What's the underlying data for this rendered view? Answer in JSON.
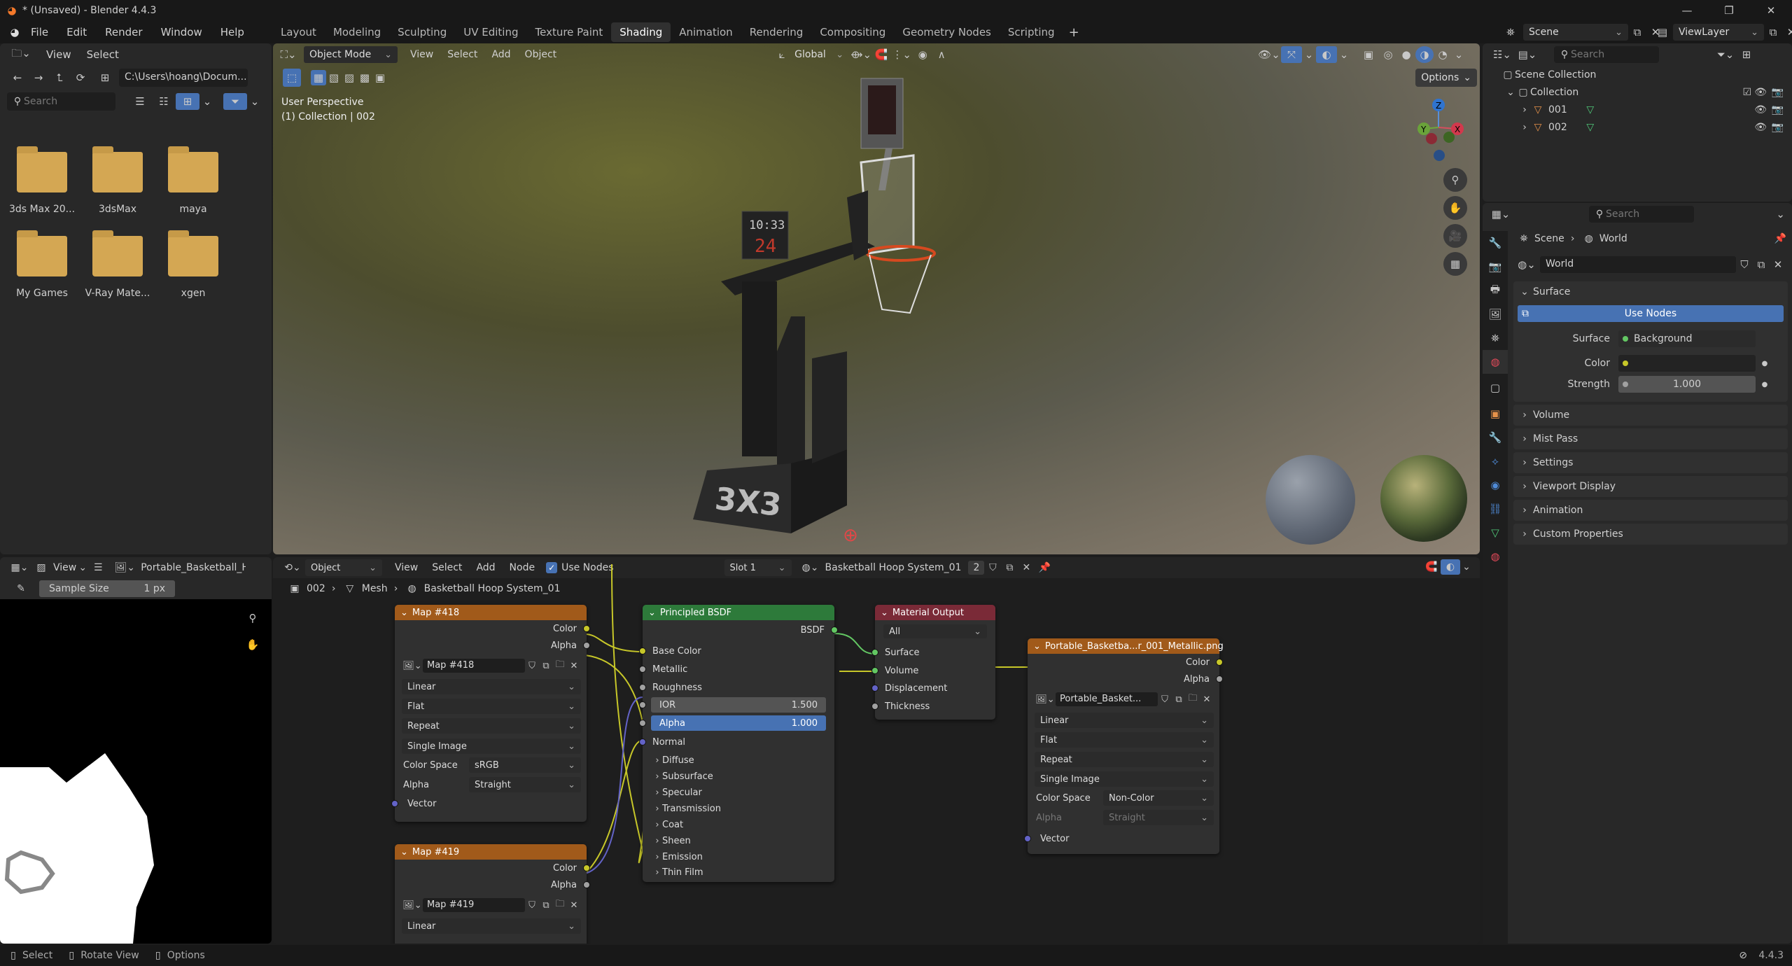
{
  "window": {
    "title": "* (Unsaved) - Blender 4.4.3"
  },
  "menu": [
    "File",
    "Edit",
    "Render",
    "Window",
    "Help"
  ],
  "workspaces": [
    "Layout",
    "Modeling",
    "Sculpting",
    "UV Editing",
    "Texture Paint",
    "Shading",
    "Animation",
    "Rendering",
    "Compositing",
    "Geometry Nodes",
    "Scripting"
  ],
  "active_workspace": "Shading",
  "scene": {
    "name": "Scene",
    "view_layer": "ViewLayer"
  },
  "filebrowser": {
    "menu": [
      "View",
      "Select"
    ],
    "path": "C:\\Users\\hoang\\Docum...",
    "search_placeholder": "Search",
    "folders": [
      "3ds Max 20...",
      "3dsMax",
      "maya",
      "My Games",
      "V-Ray Mate...",
      "xgen"
    ]
  },
  "viewport": {
    "mode": "Object Mode",
    "menu": [
      "View",
      "Select",
      "Add",
      "Object"
    ],
    "orientation": "Global",
    "options": "Options",
    "overlay_line1": "User Perspective",
    "overlay_line2": "(1) Collection | 002",
    "gizmo": {
      "x": "X",
      "y": "Y",
      "z": "Z"
    },
    "scene_text": {
      "board": "3X3",
      "clock": "10:33",
      "shot": "24"
    }
  },
  "outliner": {
    "search_placeholder": "Search",
    "root": "Scene Collection",
    "collection": "Collection",
    "items": [
      "001",
      "002"
    ]
  },
  "properties": {
    "search_placeholder": "Search",
    "breadcrumb": [
      "Scene",
      "World"
    ],
    "world_name": "World",
    "surface_panel": "Surface",
    "use_nodes": "Use Nodes",
    "surface_label": "Surface",
    "surface_value": "Background",
    "color_label": "Color",
    "strength_label": "Strength",
    "strength_value": "1.000",
    "panels": [
      "Volume",
      "Mist Pass",
      "Settings",
      "Viewport Display",
      "Animation",
      "Custom Properties"
    ]
  },
  "image_editor": {
    "view": "View",
    "image_name": "Portable_Basketball_H",
    "sample_label": "Sample Size",
    "sample_value": "1 px"
  },
  "node_editor": {
    "type": "Object",
    "menu": [
      "View",
      "Select",
      "Add",
      "Node"
    ],
    "use_nodes": "Use Nodes",
    "slot": "Slot 1",
    "material": "Basketball Hoop System_01",
    "users": "2",
    "breadcrumb": [
      "002",
      "Mesh",
      "Basketball Hoop System_01"
    ]
  },
  "nodes": {
    "map418": {
      "title": "Map #418",
      "out": [
        "Color",
        "Alpha"
      ],
      "image": "Map #418",
      "interp": "Linear",
      "proj": "Flat",
      "ext": "Repeat",
      "src": "Single Image",
      "cs_label": "Color Space",
      "cs": "sRGB",
      "alpha_label": "Alpha",
      "alpha": "Straight",
      "vector": "Vector"
    },
    "map419": {
      "title": "Map #419",
      "out": [
        "Color",
        "Alpha"
      ],
      "image": "Map #419",
      "interp": "Linear"
    },
    "bsdf": {
      "title": "Principled BSDF",
      "out": "BSDF",
      "inputs": [
        "Base Color",
        "Metallic",
        "Roughness"
      ],
      "ior_label": "IOR",
      "ior": "1.500",
      "alpha_label": "Alpha",
      "alpha": "1.000",
      "normal": "Normal",
      "sections": [
        "Diffuse",
        "Subsurface",
        "Specular",
        "Transmission",
        "Coat",
        "Sheen",
        "Emission",
        "Thin Film"
      ]
    },
    "output": {
      "title": "Material Output",
      "target": "All",
      "inputs": [
        "Surface",
        "Volume",
        "Displacement",
        "Thickness"
      ]
    },
    "metal": {
      "title": "Portable_Basketba...r_001_Metallic.png",
      "out": [
        "Color",
        "Alpha"
      ],
      "image": "Portable_Basket...",
      "interp": "Linear",
      "proj": "Flat",
      "ext": "Repeat",
      "src": "Single Image",
      "cs_label": "Color Space",
      "cs": "Non-Color",
      "alpha_label": "Alpha",
      "alpha": "Straight",
      "vector": "Vector"
    }
  },
  "statusbar": {
    "items": [
      "Select",
      "Rotate View",
      "Options"
    ],
    "version": "4.4.3"
  },
  "colors": {
    "accent": "#4772b3",
    "bg": "#1d1d1d",
    "panel": "#303030",
    "tex_header": "#a15a1a",
    "shader_header": "#2d7a3a",
    "output_header": "#7a2a37",
    "yellow_socket": "#c7c729",
    "gray_socket": "#a1a1a1",
    "purple_socket": "#6363c7",
    "green_socket": "#63c763"
  }
}
